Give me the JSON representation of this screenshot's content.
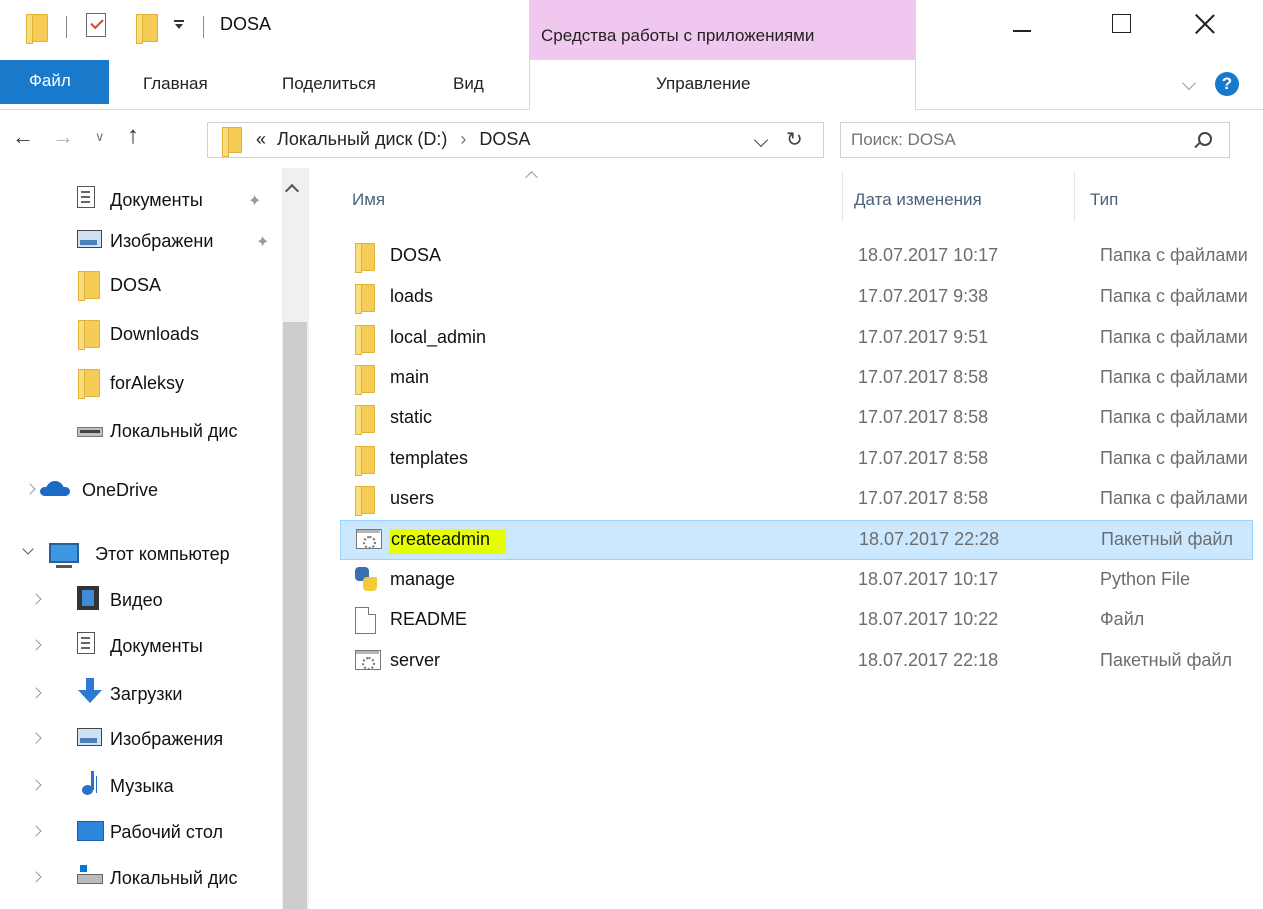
{
  "window": {
    "title": "DOSA",
    "context_tab": "Средства работы с приложениями"
  },
  "ribbon": {
    "tabs": [
      "Файл",
      "Главная",
      "Поделиться",
      "Вид"
    ],
    "manage_tab": "Управление"
  },
  "address": {
    "overflow": "«",
    "segments": [
      "Локальный диск (D:)",
      "DOSA"
    ]
  },
  "search": {
    "placeholder": "Поиск: DOSA"
  },
  "nav": {
    "items": [
      {
        "label": "Документы",
        "icon": "documents-icon",
        "pinned": true
      },
      {
        "label": "Изображени",
        "icon": "pictures-icon",
        "pinned": true
      },
      {
        "label": "DOSA",
        "icon": "folder-icon"
      },
      {
        "label": "Downloads",
        "icon": "folder-icon"
      },
      {
        "label": "forAleksy",
        "icon": "folder-icon"
      },
      {
        "label": "Локальный дис",
        "icon": "drive-icon"
      },
      {
        "label": "OneDrive",
        "icon": "onedrive-icon"
      },
      {
        "label": "Этот компьютер",
        "icon": "computer-icon"
      },
      {
        "label": "Видео",
        "icon": "video-icon"
      },
      {
        "label": "Документы",
        "icon": "documents-icon"
      },
      {
        "label": "Загрузки",
        "icon": "downloads-icon"
      },
      {
        "label": "Изображения",
        "icon": "pictures-icon"
      },
      {
        "label": "Музыка",
        "icon": "music-icon"
      },
      {
        "label": "Рабочий стол",
        "icon": "desktop-icon"
      },
      {
        "label": "Локальный дис",
        "icon": "drive-icon"
      }
    ]
  },
  "columns": {
    "name": "Имя",
    "date": "Дата изменения",
    "type": "Тип"
  },
  "files": [
    {
      "name": "DOSA",
      "date": "18.07.2017 10:17",
      "type": "Папка с файлами",
      "icon": "folder-icon"
    },
    {
      "name": "loads",
      "date": "17.07.2017 9:38",
      "type": "Папка с файлами",
      "icon": "folder-icon"
    },
    {
      "name": "local_admin",
      "date": "17.07.2017 9:51",
      "type": "Папка с файлами",
      "icon": "folder-icon"
    },
    {
      "name": "main",
      "date": "17.07.2017 8:58",
      "type": "Папка с файлами",
      "icon": "folder-icon"
    },
    {
      "name": "static",
      "date": "17.07.2017 8:58",
      "type": "Папка с файлами",
      "icon": "folder-icon"
    },
    {
      "name": "templates",
      "date": "17.07.2017 8:58",
      "type": "Папка с файлами",
      "icon": "folder-icon"
    },
    {
      "name": "users",
      "date": "17.07.2017 8:58",
      "type": "Папка с файлами",
      "icon": "folder-icon"
    },
    {
      "name": "createadmin",
      "date": "18.07.2017 22:28",
      "type": "Пакетный файл",
      "icon": "batch-file-icon",
      "selected": true
    },
    {
      "name": "manage",
      "date": "18.07.2017 10:17",
      "type": "Python File",
      "icon": "python-file-icon"
    },
    {
      "name": "README",
      "date": "18.07.2017 10:22",
      "type": "Файл",
      "icon": "file-icon"
    },
    {
      "name": "server",
      "date": "18.07.2017 22:18",
      "type": "Пакетный файл",
      "icon": "batch-file-icon"
    }
  ],
  "colors": {
    "accent": "#1979ca",
    "context": "#efc7ef",
    "selection": "#cce8ff",
    "highlight": "#e5ff00"
  }
}
